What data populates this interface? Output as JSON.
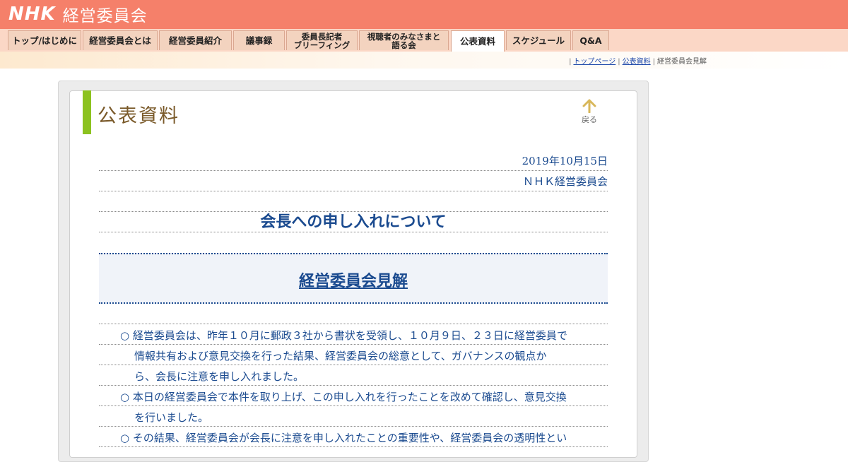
{
  "header": {
    "logo": "NHK",
    "title": "経営委員会"
  },
  "nav": {
    "tabs": [
      {
        "label": "トップ/はじめに"
      },
      {
        "label": "経営委員会とは"
      },
      {
        "label": "経営委員紹介"
      },
      {
        "label": "議事録"
      },
      {
        "label": "委員長記者\nブリーフィング"
      },
      {
        "label": "視聴者のみなさまと\n語る会"
      },
      {
        "label": "公表資料"
      },
      {
        "label": "スケジュール"
      },
      {
        "label": "Q&A"
      }
    ]
  },
  "breadcrumb": {
    "home": "トップページ",
    "section": "公表資料",
    "current": "経営委員会見解"
  },
  "page": {
    "section_title": "公表資料",
    "back_label": "戻る"
  },
  "document": {
    "date": "2019年10月15日",
    "author": "ＮＨＫ経営委員会",
    "headline": "会長への申し入れについて",
    "subtitle": "経営委員会見解",
    "paragraphs": [
      "○ 経営委員会は、昨年１０月に郵政３社から書状を受領し、１０月９日、２３日に経営委員で",
      "情報共有および意見交換を行った結果、経営委員会の総意として、ガバナンスの観点か",
      "ら、会長に注意を申し入れました。",
      "○ 本日の経営委員会で本件を取り上げ、この申し入れを行ったことを改めて確認し、意見交換",
      "を行いました。",
      "○ その結果、経営委員会が会長に注意を申し入れたことの重要性や、経営委員会の透明性とい"
    ]
  },
  "colors": {
    "header_bg": "#f5806a",
    "nav_bg": "#fbd7c6",
    "accent_green": "#8cc21f",
    "text_blue": "#1a4a8f"
  }
}
